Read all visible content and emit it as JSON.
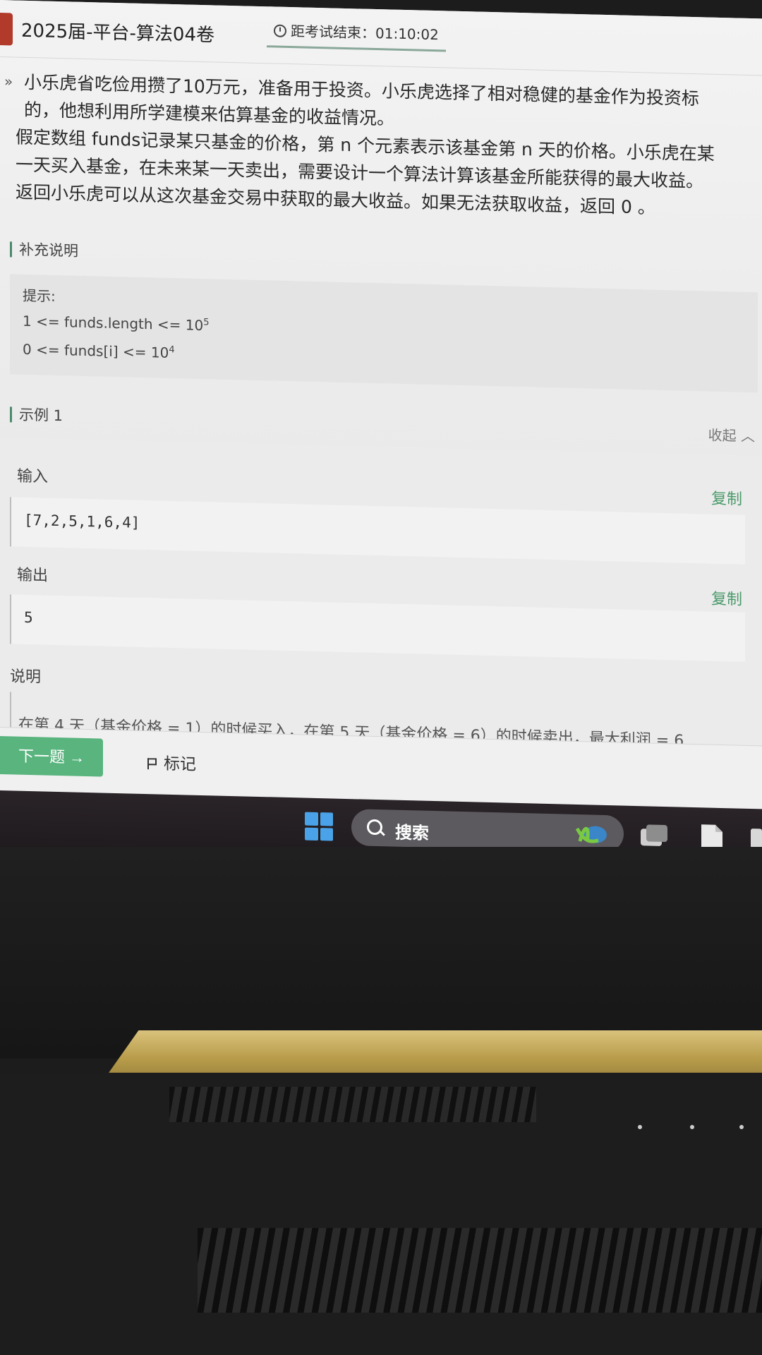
{
  "header": {
    "exam_title": "2025届-平台-算法04卷",
    "timer_label": "距考试结束：",
    "timer_value": "01:10:02"
  },
  "question": {
    "lines": [
      "小乐虎省吃俭用攒了10万元，准备用于投资。小乐虎选择了相对稳健的基金作为投资标",
      "的，他想利用所学建模来估算基金的收益情况。",
      "假定数组 funds记录某只基金的价格，第 n 个元素表示该基金第 n 天的价格。小乐虎在某",
      "一天买入基金，在未来某一天卖出，需要设计一个算法计算该基金所能获得的最大收益。",
      "返回小乐虎可以从这次基金交易中获取的最大收益。如果无法获取收益，返回 0 。"
    ]
  },
  "supplement": {
    "heading": "补充说明",
    "hint_title": "提示:",
    "constraint1": "1 <= funds.length <= 10",
    "constraint1_exp": "5",
    "constraint2": "0 <= funds[i] <= 10",
    "constraint2_exp": "4"
  },
  "example": {
    "heading": "示例 1",
    "collapse_label": "收起",
    "input_label": "输入",
    "input_value": "[7,2,5,1,6,4]",
    "output_label": "输出",
    "output_value": "5",
    "copy_label": "复制",
    "explain_label": "说明",
    "explain_text": "在第 4 天（基金价格 = 1）的时候买入，在第 5 天（基金价格 = 6）的时候卖出，最大利润 = 6"
  },
  "footer": {
    "next_label": "下一题 →",
    "mark_label": "标记"
  },
  "taskbar": {
    "search_label": "搜索"
  },
  "colors": {
    "accent_green": "#59b47e",
    "copy_green": "#4a9a6a",
    "windows_blue": "#4aa3e8"
  }
}
